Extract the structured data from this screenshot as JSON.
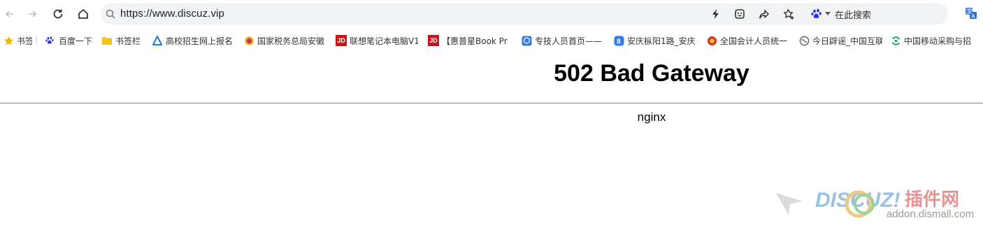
{
  "browser": {
    "url": "https://www.discuz.vip",
    "search_engine_label": "在此搜索"
  },
  "bookmarks": [
    {
      "label": "书签",
      "icon": "star-icon"
    },
    {
      "label": "百度一下",
      "icon": "baidu-paw-icon"
    },
    {
      "label": "书签栏",
      "icon": "folder-icon"
    },
    {
      "label": "高校招生网上报名",
      "icon": "triangle-logo-icon"
    },
    {
      "label": "国家税务总局安徽",
      "icon": "tax-emblem-icon"
    },
    {
      "label": "联想笔记本电脑V1",
      "icon": "jd-icon"
    },
    {
      "label": "【惠普星Book Pr",
      "icon": "jd-icon"
    },
    {
      "label": "专技人员首页——",
      "icon": "cube-icon"
    },
    {
      "label": "安庆枞阳1路_安庆",
      "icon": "bus-8-icon"
    },
    {
      "label": "全国会计人员统一",
      "icon": "emblem-icon"
    },
    {
      "label": "今日辟谣_中国互联",
      "icon": "globe-icon"
    },
    {
      "label": "中国移动采购与招",
      "icon": "china-mobile-icon"
    }
  ],
  "page": {
    "title": "502 Bad Gateway",
    "server": "nginx"
  },
  "watermark": {
    "brand": "DISCUZ!",
    "cn": "插件网",
    "url": "addon.dismall.com"
  },
  "colors": {
    "urlbar_bg": "#f1f3f4",
    "jd_red": "#c4161c",
    "folder_yellow": "#f5c518"
  }
}
